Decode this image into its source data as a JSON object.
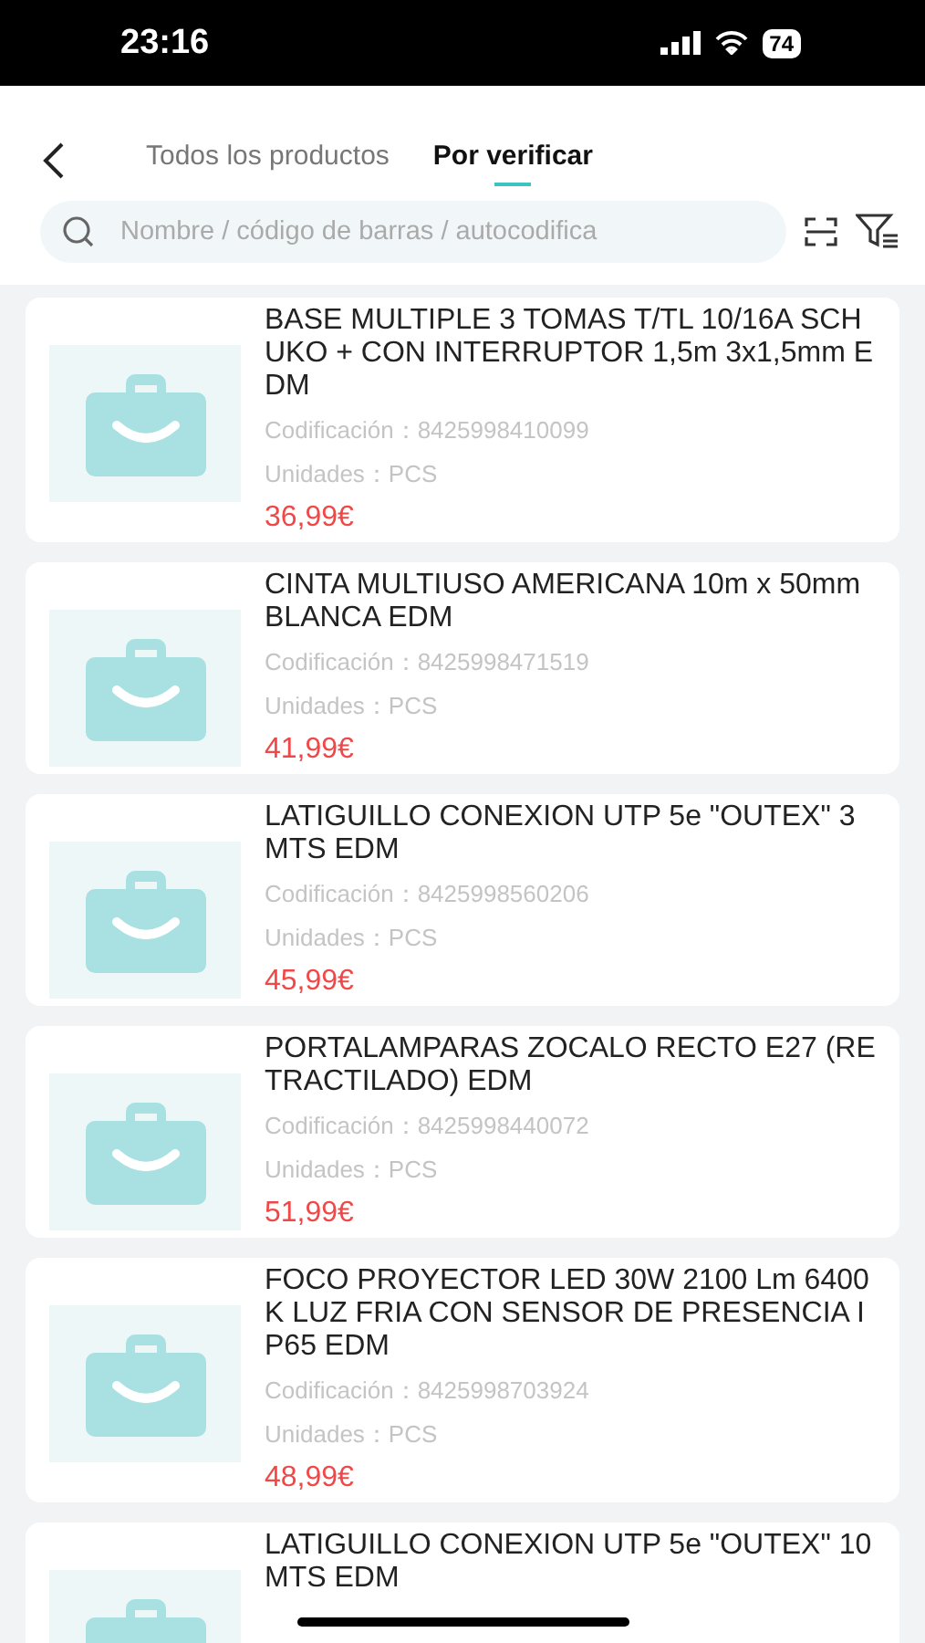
{
  "status_bar": {
    "time": "23:16",
    "battery": "74"
  },
  "tabs": [
    {
      "label": "Todos los productos",
      "selected": false
    },
    {
      "label": "Por verificar",
      "selected": true
    }
  ],
  "search": {
    "placeholder": "Nombre / código de barras / autocodifica"
  },
  "products": [
    {
      "name": "BASE MULTIPLE 3 TOMAS T/TL 10/16A SCHUKO + CON INTERRUPTOR 1,5m 3x1,5mm EDM",
      "code": "Codificación：8425998410099",
      "units": "Unidades：PCS",
      "price": "36,99€"
    },
    {
      "name": "CINTA MULTIUSO AMERICANA 10m x 50mm BLANCA EDM",
      "code": "Codificación：8425998471519",
      "units": "Unidades：PCS",
      "price": "41,99€"
    },
    {
      "name": "LATIGUILLO CONEXION UTP 5e \"OUTEX\" 3MTS EDM",
      "code": "Codificación：8425998560206",
      "units": "Unidades：PCS",
      "price": "45,99€"
    },
    {
      "name": "PORTALAMPARAS ZOCALO RECTO E27 (RETRACTILADO) EDM",
      "code": "Codificación：8425998440072",
      "units": "Unidades：PCS",
      "price": "51,99€"
    },
    {
      "name": "FOCO PROYECTOR LED 30W 2100 Lm 6400K LUZ FRIA CON SENSOR DE PRESENCIA IP65 EDM",
      "code": "Codificación：8425998703924",
      "units": "Unidades：PCS",
      "price": "48,99€"
    },
    {
      "name": "LATIGUILLO CONEXION UTP 5e \"OUTEX\" 10MTS EDM"
    }
  ]
}
